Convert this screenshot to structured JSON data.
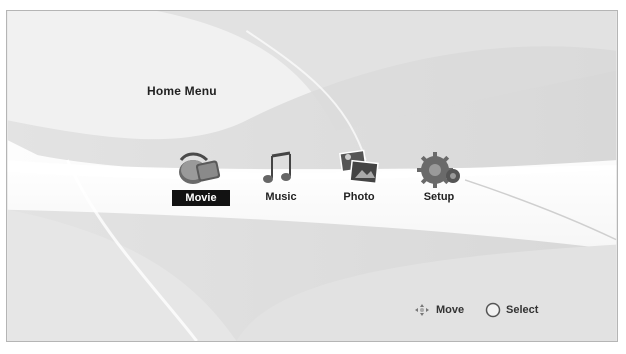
{
  "header": {
    "title": "Home Menu"
  },
  "menu": {
    "items": [
      {
        "label": "Movie",
        "icon": "movie-icon",
        "selected": true
      },
      {
        "label": "Music",
        "icon": "music-note-icon",
        "selected": false
      },
      {
        "label": "Photo",
        "icon": "photo-icon",
        "selected": false
      },
      {
        "label": "Setup",
        "icon": "gear-icon",
        "selected": false
      }
    ]
  },
  "footer": {
    "move_label": "Move",
    "select_label": "Select",
    "move_icon": "dpad-arrows-icon",
    "select_icon": "ok-circle-icon"
  },
  "colors": {
    "selected_bg": "#121212",
    "selected_text": "#ffffff",
    "text": "#222222"
  }
}
